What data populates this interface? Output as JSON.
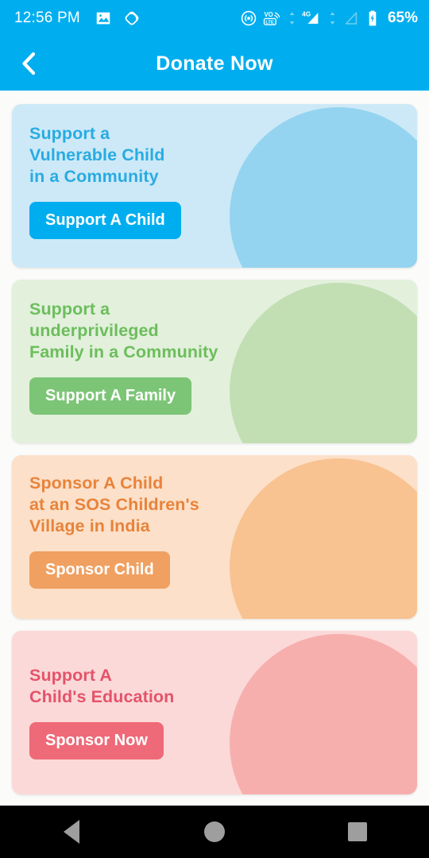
{
  "status_bar": {
    "time": "12:56 PM",
    "battery_percent": "65%",
    "left_icons": [
      "image-icon",
      "screen-rotation-icon"
    ],
    "right_icons": [
      "hotspot-icon",
      "volte-icon",
      "signal-4g-icon",
      "signal-bars-icon",
      "battery-charging-icon"
    ],
    "background_color": "#00AEEF"
  },
  "app_bar": {
    "title": "Donate Now",
    "back_icon": "chevron-left-icon",
    "background_color": "#00AEEF",
    "title_color": "#FFFFFF"
  },
  "page": {
    "background_color": "#FBFBFA"
  },
  "cards": [
    {
      "id": "support-a-vulnerable-child",
      "title": "Support a\nVulnerable Child\nin a Community",
      "button_label": "Support A Child",
      "card_color": "#CDE9F7",
      "blob_color": "#95D4F0",
      "title_color": "#29ABE2",
      "button_color": "#00AEEF",
      "button_text_color": "#FFFFFF"
    },
    {
      "id": "support-an-underprivileged-family",
      "title": "Support a\nunderprivileged\nFamily in a Community",
      "button_label": "Support A Family",
      "card_color": "#E2F0DC",
      "blob_color": "#C2DFB4",
      "title_color": "#6CBE5B",
      "button_color": "#7CC576",
      "button_text_color": "#FFFFFF"
    },
    {
      "id": "sponsor-a-child-sos-village",
      "title": "Sponsor A Child\nat an SOS Children's\nVillage in India",
      "button_label": "Sponsor Child",
      "card_color": "#FCE0C9",
      "blob_color": "#F8C391",
      "title_color": "#E8833A",
      "button_color": "#F0A060",
      "button_text_color": "#FFFFFF"
    },
    {
      "id": "support-a-childs-education",
      "title": "Support A\nChild's Education",
      "button_label": "Sponsor Now",
      "card_color": "#FBD9D8",
      "blob_color": "#F7AFAE",
      "title_color": "#E4536A",
      "button_color": "#EE6A78",
      "button_text_color": "#FFFFFF"
    }
  ],
  "nav_bar": {
    "background_color": "#000000",
    "buttons": [
      {
        "name": "back",
        "icon": "triangle-back-icon"
      },
      {
        "name": "home",
        "icon": "circle-home-icon"
      },
      {
        "name": "recents",
        "icon": "square-recents-icon"
      }
    ]
  }
}
